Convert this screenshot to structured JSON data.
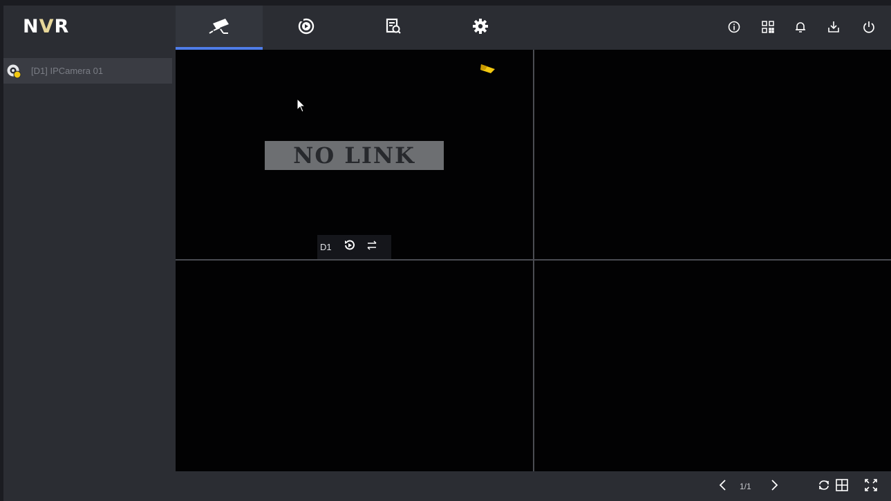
{
  "app": {
    "logo_prefix": "N",
    "logo_v": "V",
    "logo_suffix": "R"
  },
  "nav_tabs": [
    {
      "id": "live-view",
      "icon": "surveillance-camera-icon",
      "active": true
    },
    {
      "id": "playback",
      "icon": "playback-icon",
      "active": false
    },
    {
      "id": "file-search",
      "icon": "file-search-icon",
      "active": false
    },
    {
      "id": "settings",
      "icon": "gear-icon",
      "active": false
    }
  ],
  "toolbar_right": [
    "info-icon",
    "qr-code-icon",
    "bell-icon",
    "download-icon",
    "power-icon"
  ],
  "sidebar": {
    "items": [
      {
        "label": "[D1] IPCamera 01",
        "status": "offline"
      }
    ]
  },
  "live": {
    "cell1": {
      "status_text": "NO LINK",
      "channel": "D1",
      "buttons": [
        "instant-playback-icon",
        "switch-stream-icon"
      ]
    }
  },
  "bottom": {
    "page": "1/1",
    "buttons": [
      "prev-page-icon",
      "next-page-icon",
      "auto-switch-icon",
      "layout-grid-icon",
      "fullscreen-icon"
    ]
  },
  "colors": {
    "accent": "#4f7de8",
    "bar": "#2b2d33",
    "nolink_bg": "#6d6f72",
    "camera_flag": "#f2c811"
  }
}
